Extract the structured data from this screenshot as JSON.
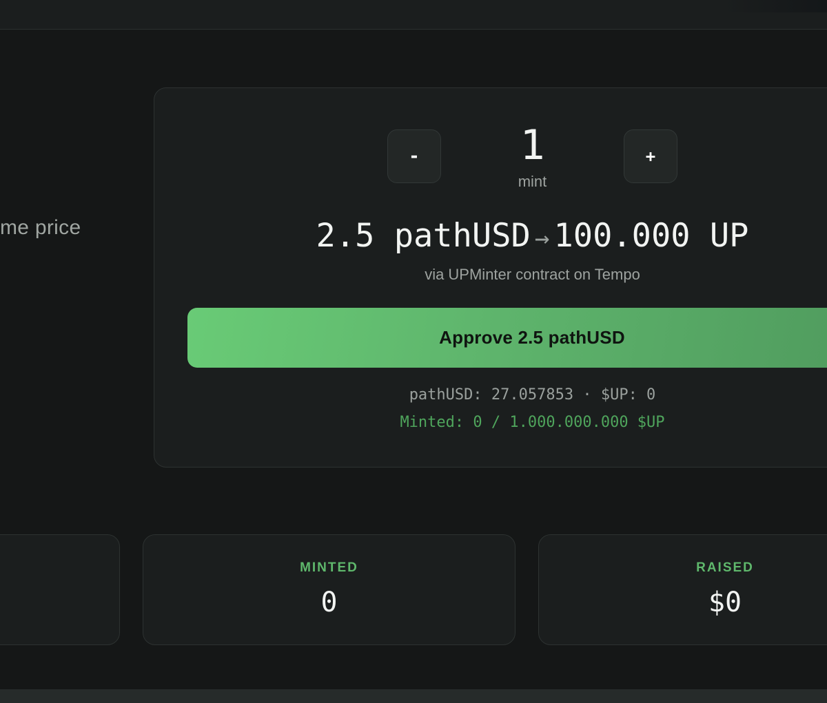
{
  "hero": {
    "tagline_fragment": "me price"
  },
  "mint": {
    "decrement_label": "-",
    "increment_label": "+",
    "quantity": "1",
    "quantity_unit": "mint",
    "pay_amount": "2.5 pathUSD",
    "arrow": "→",
    "receive_amount": "100.000 UP",
    "via_text": "via UPMinter contract on Tempo",
    "approve_label": "Approve 2.5 pathUSD",
    "balances_text": "pathUSD: 27.057853 · $UP: 0",
    "minted_text": "Minted: 0 / 1.000.000.000 $UP"
  },
  "stats": [
    {
      "label": "",
      "value": ""
    },
    {
      "label": "MINTED",
      "value": "0"
    },
    {
      "label": "RAISED",
      "value": "$0"
    }
  ],
  "colors": {
    "background": "#151717",
    "card": "#1b1e1e",
    "accent_green": "#5fb86c",
    "button_gradient_start": "#69cb76",
    "button_gradient_end": "#4f9a5d"
  }
}
